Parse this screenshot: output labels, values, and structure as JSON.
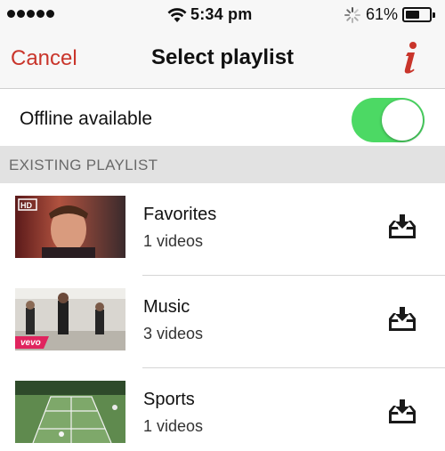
{
  "status_bar": {
    "time": "5:34 pm",
    "battery_percent": "61%",
    "battery_level": 0.61,
    "icons": [
      "signal-dots-icon",
      "wifi-icon",
      "activity-spinner-icon",
      "battery-icon"
    ]
  },
  "nav": {
    "cancel_label": "Cancel",
    "title": "Select playlist",
    "info_icon": "info-icon"
  },
  "offline": {
    "label": "Offline available",
    "enabled": true
  },
  "section_header": "EXISTING PLAYLIST",
  "playlists": [
    {
      "name": "Favorites",
      "count": "1 videos",
      "thumbnail_badge": "HD"
    },
    {
      "name": "Music",
      "count": "3 videos",
      "thumbnail_badge": "vevo"
    },
    {
      "name": "Sports",
      "count": "1 videos",
      "thumbnail_badge": ""
    }
  ],
  "colors": {
    "accent": "#c9352b",
    "toggle_on": "#4cd964",
    "section_bg": "#e2e2e2",
    "bar_bg": "#f7f7f7"
  }
}
